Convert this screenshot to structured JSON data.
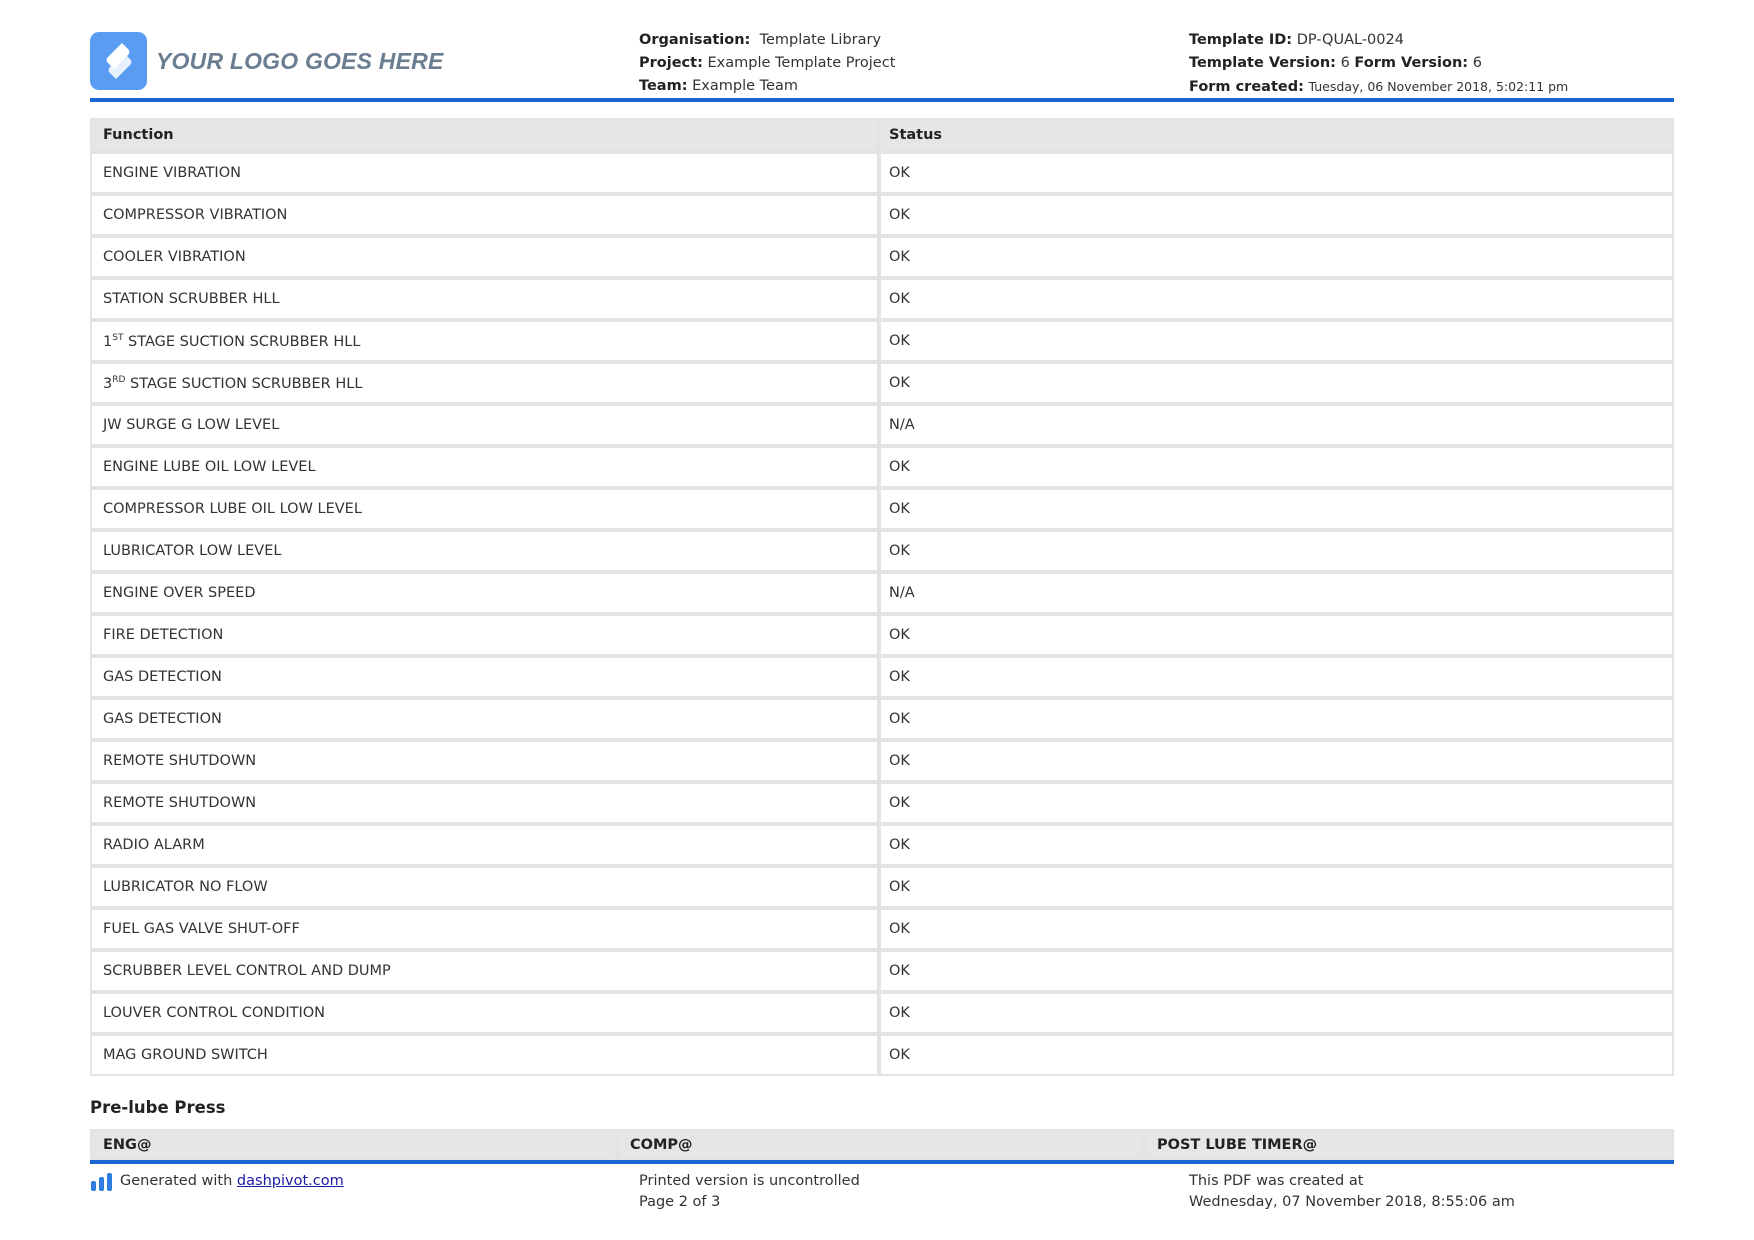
{
  "header": {
    "logo_text": "YOUR LOGO GOES HERE",
    "organisation_label": "Organisation:",
    "organisation_value": "Template Library",
    "project_label": "Project:",
    "project_value": "Example Template Project",
    "team_label": "Team:",
    "team_value": "Example Team",
    "template_id_label": "Template ID:",
    "template_id_value": "DP-QUAL-0024",
    "template_version_label": "Template Version:",
    "template_version_value": "6",
    "form_version_label": "Form Version:",
    "form_version_value": "6",
    "form_created_label": "Form created:",
    "form_created_value": "Tuesday, 06 November 2018, 5:02:11 pm"
  },
  "table": {
    "headers": [
      "Function",
      "Status"
    ],
    "rows": [
      {
        "function": "ENGINE VIBRATION",
        "status": "OK"
      },
      {
        "function": "COMPRESSOR VIBRATION",
        "status": "OK"
      },
      {
        "function": "COOLER VIBRATION",
        "status": "OK"
      },
      {
        "function": "STATION SCRUBBER HLL",
        "status": "OK"
      },
      {
        "num": "1",
        "sup": "ST",
        "rest": " STAGE SUCTION SCRUBBER HLL",
        "status": "OK"
      },
      {
        "num": "3",
        "sup": "RD",
        "rest": " STAGE SUCTION SCRUBBER HLL",
        "status": "OK"
      },
      {
        "function": "JW SURGE G LOW LEVEL",
        "status": "N/A"
      },
      {
        "function": "ENGINE LUBE OIL LOW LEVEL",
        "status": "OK"
      },
      {
        "function": "COMPRESSOR LUBE OIL LOW LEVEL",
        "status": "OK"
      },
      {
        "function": "LUBRICATOR LOW LEVEL",
        "status": "OK"
      },
      {
        "function": "ENGINE OVER SPEED",
        "status": "N/A"
      },
      {
        "function": "FIRE DETECTION",
        "status": "OK"
      },
      {
        "function": "GAS DETECTION",
        "status": "OK"
      },
      {
        "function": "GAS DETECTION",
        "status": "OK"
      },
      {
        "function": "REMOTE SHUTDOWN",
        "status": "OK"
      },
      {
        "function": "REMOTE SHUTDOWN",
        "status": "OK"
      },
      {
        "function": "RADIO ALARM",
        "status": "OK"
      },
      {
        "function": "LUBRICATOR NO FLOW",
        "status": "OK"
      },
      {
        "function": "FUEL GAS VALVE SHUT-OFF",
        "status": "OK"
      },
      {
        "function": "SCRUBBER LEVEL CONTROL AND DUMP",
        "status": "OK"
      },
      {
        "function": "LOUVER CONTROL CONDITION",
        "status": "OK"
      },
      {
        "function": "MAG GROUND SWITCH",
        "status": "OK"
      }
    ]
  },
  "prelube": {
    "title": "Pre-lube Press",
    "headers": [
      "ENG@",
      "COMP@",
      "POST LUBE TIMER@"
    ]
  },
  "footer": {
    "generated_text": "Generated with ",
    "generated_link": "dashpivot.com",
    "uncontrolled": "Printed version is uncontrolled",
    "page": "Page 2 of 3",
    "pdf_created_label": "This PDF was created at",
    "pdf_created_value": "Wednesday, 07 November 2018, 8:55:06 am"
  },
  "colors": {
    "accent": "#1a66d2",
    "logo": "#5b9cf3",
    "header_bg": "#e6e6e6"
  }
}
